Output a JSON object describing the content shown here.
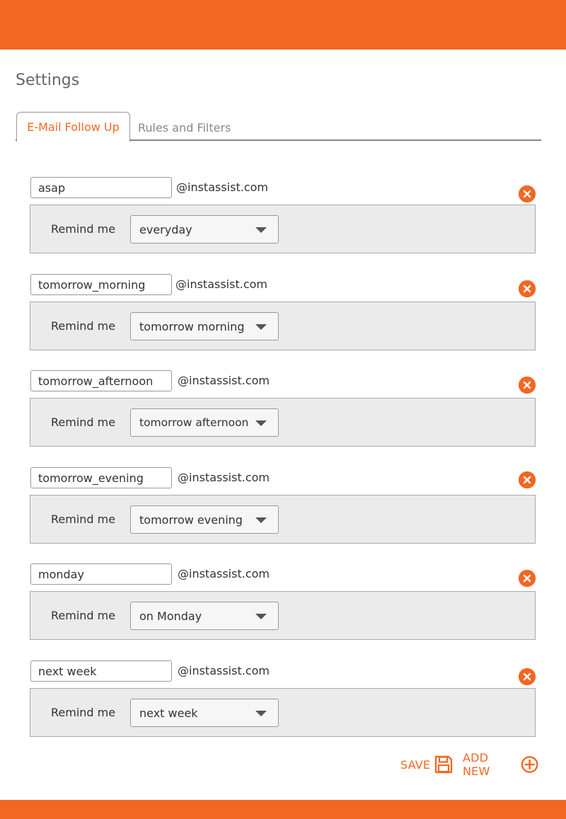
{
  "header": {
    "brand_color": "#f26722"
  },
  "page": {
    "title": "Settings"
  },
  "tabs": [
    {
      "label": "E-Mail Follow Up",
      "active": true
    },
    {
      "label": "Rules and Filters",
      "active": false
    }
  ],
  "rules": [
    {
      "address": "asap",
      "domain": "@instassist.com",
      "remind_label": "Remind me",
      "remind_value": "everyday"
    },
    {
      "address": "tomorrow_morning",
      "domain": "@instassist.com",
      "remind_label": "Remind me",
      "remind_value": "tomorrow morning"
    },
    {
      "address": "tomorrow_afternoon",
      "domain": "@instassist.com",
      "remind_label": "Remind me",
      "remind_value": "tomorrow afternoon"
    },
    {
      "address": "tomorrow_evening",
      "domain": "@instassist.com",
      "remind_label": "Remind me",
      "remind_value": "tomorrow evening"
    },
    {
      "address": "monday",
      "domain": "@instassist.com",
      "remind_label": "Remind me",
      "remind_value": "on Monday"
    },
    {
      "address": "next week",
      "domain": "@instassist.com",
      "remind_label": "Remind me",
      "remind_value": "next week"
    }
  ],
  "actions": {
    "save_label": "SAVE",
    "add_new_label": "ADD NEW"
  },
  "icons": {
    "delete": "close-circle-icon",
    "save": "floppy-disk-icon",
    "add": "plus-circle-icon"
  }
}
